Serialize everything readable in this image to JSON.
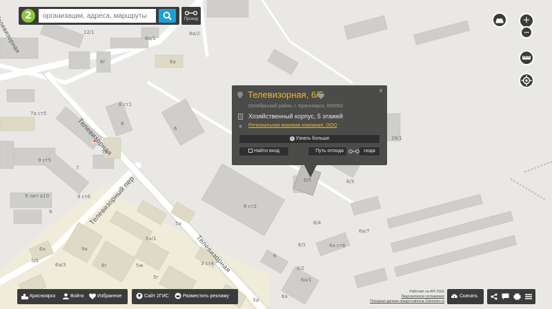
{
  "search": {
    "placeholder": "организации, адреса, маршруты",
    "logo_text": "2"
  },
  "route": {
    "label": "Проезд"
  },
  "zoom": {
    "in": "+",
    "out": "−"
  },
  "popup": {
    "title": "Телевизорная, 6/5",
    "address": "Октябрьский район, г. Красноярск, 660062",
    "description": "Хозяйственный корпус, 5 этажей",
    "firm": "Региональная жировая компания, ООО",
    "more": "Узнать больше",
    "find_entrance": "Найти вход",
    "route_from": "Путь отсюда",
    "route_to": "сюда",
    "close": "×"
  },
  "map": {
    "streets": [
      "Телевизорная",
      "Телевизорный пер",
      "Телевизорная",
      "Телевизорная"
    ],
    "labels": [
      "12/1",
      "8а/2",
      "8а/1",
      "8г",
      "8а",
      "7а ст5",
      "8 ст1",
      "8",
      "6",
      "16/1",
      "7а",
      "7",
      "9 ст5",
      "9 ст6",
      "9 лит в10",
      "9",
      "9а",
      "6г",
      "5а/1",
      "5ж",
      "3 ст4",
      "5а",
      "5г",
      "6а",
      "3д",
      "6/3",
      "8 ст2",
      "6/4",
      "6а/7",
      "6/1",
      "6а ст6",
      "6",
      "6/2",
      "6а/1",
      "6а",
      "5/1",
      "6а/3",
      "6/5",
      "5"
    ]
  },
  "bottom": {
    "city": "Красноярск",
    "login": "Войти",
    "favorites": "Избранное",
    "site": "Сайт 2ГИС",
    "ads": "Разместить рекламу",
    "download": "Скачать",
    "attribution": [
      "Работает на API 2GIS",
      "Лицензионное соглашение",
      "Погодные данные предоставлены Gismeteo.ru"
    ]
  }
}
